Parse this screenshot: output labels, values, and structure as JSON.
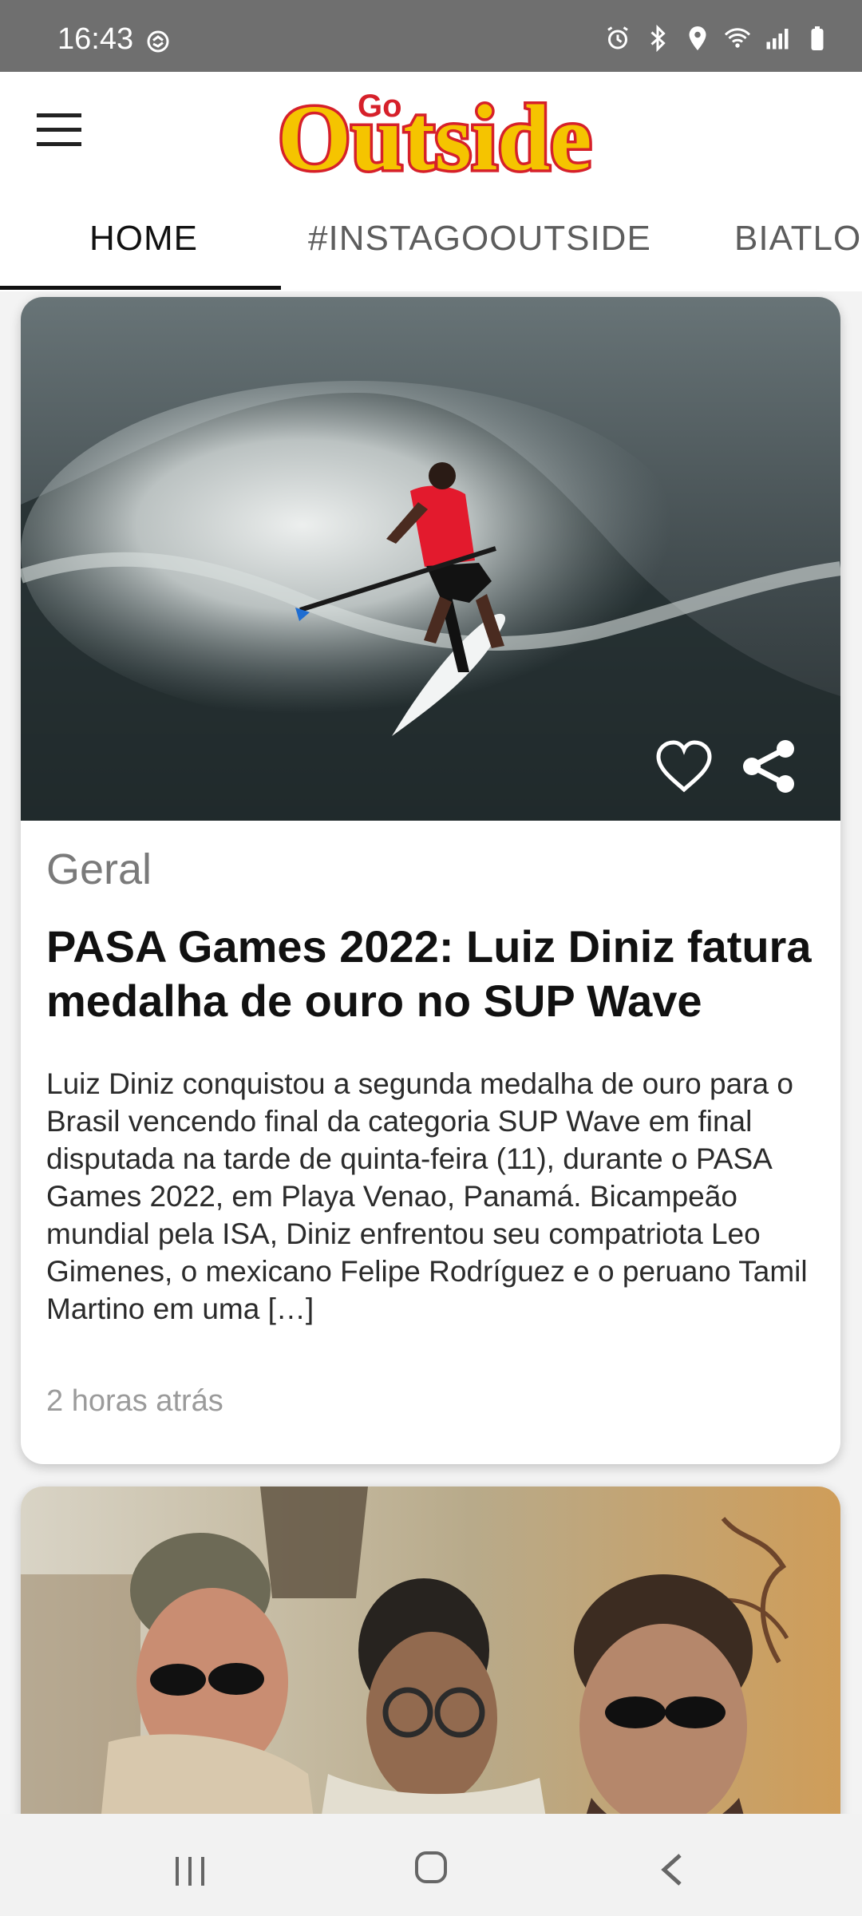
{
  "status_bar": {
    "time": "16:43",
    "left_icon": "sync-icon",
    "right_icons": [
      "alarm-icon",
      "bluetooth-icon",
      "location-icon",
      "wifi-icon",
      "signal-icon",
      "battery-icon"
    ]
  },
  "app_bar": {
    "menu_icon": "hamburger-menu-icon",
    "logo_small": "Go",
    "logo_text": "Outside"
  },
  "tabs": [
    {
      "label": "HOME"
    },
    {
      "label": "#INSTAGOOUTSIDE"
    },
    {
      "label": "BIATLO"
    }
  ],
  "articles": [
    {
      "category": "Geral",
      "title": "PASA Games 2022: Luiz Diniz fatura medalha de ouro no SUP Wave",
      "excerpt": "Luiz Diniz conquistou a segunda medalha de ouro para o Brasil vencendo final da categoria SUP Wave em final disputada na tarde de quinta-feira (11), durante o PASA Games 2022, em Playa Venao, Panamá. Bicampeão mundial pela ISA, Diniz enfrentou seu compatriota Leo Gimenes, o mexicano Felipe Rodríguez e o peruano Tamil Martino em uma […]",
      "time": "2 horas atrás",
      "actions": [
        "heart-icon",
        "share-icon"
      ]
    }
  ],
  "colors": {
    "status_bar": "#6f6f6f",
    "logo_yellow": "#f5c400",
    "logo_red": "#d6202a",
    "active_tab": "#111111"
  },
  "nav_bar": {
    "icons": [
      "recents-icon",
      "home-icon",
      "back-icon"
    ]
  }
}
